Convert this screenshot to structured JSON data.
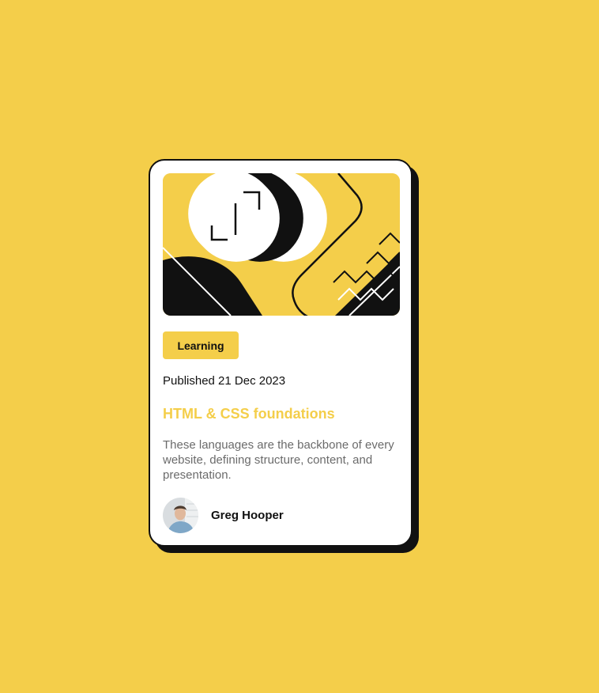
{
  "card": {
    "tag": "Learning",
    "published": "Published 21 Dec 2023",
    "title": "HTML & CSS foundations",
    "description": "These languages are the backbone of every website, defining structure, content, and presentation.",
    "author": {
      "name": "Greg Hooper"
    },
    "hero_image": "abstract-illustration"
  },
  "colors": {
    "background": "#F4CE4A",
    "card": "#FFFFFF",
    "ink": "#111111",
    "muted_text": "#6B6B6B",
    "accent": "#F4CE4A"
  }
}
